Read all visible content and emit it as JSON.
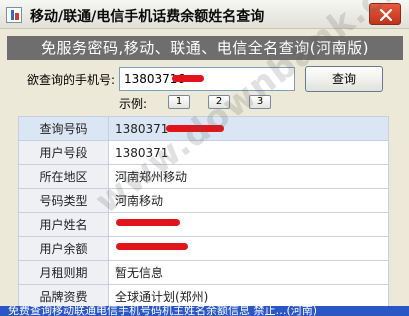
{
  "window": {
    "title": "移动/联通/电信手机话费余额姓名查询"
  },
  "banner": {
    "text": "免服务密码,移动、联通、电信全名查询(河南版)"
  },
  "query": {
    "label": "欲查询的手机号:",
    "value": "13803716",
    "button_label": "查询"
  },
  "examples": {
    "label": "示例:",
    "buttons": [
      "1",
      "2",
      "3"
    ]
  },
  "results": [
    {
      "key": "查询号码",
      "value": "1380371"
    },
    {
      "key": "用户号段",
      "value": "1380371"
    },
    {
      "key": "所在地区",
      "value": "河南郑州移动"
    },
    {
      "key": "号码类型",
      "value": "河南移动"
    },
    {
      "key": "用户姓名",
      "value": ""
    },
    {
      "key": "用户余额",
      "value": ""
    },
    {
      "key": "月租则期",
      "value": "暂无信息"
    },
    {
      "key": "品牌资费",
      "value": "全球通计划(郑州)"
    }
  ],
  "watermark": {
    "text": "www.downbank.cn"
  },
  "footer": {
    "text": "免费查询移动联通电信手机号码机主姓名余额信息  禁止…(河南)"
  },
  "colors": {
    "banner_bg": "#6e6e6e",
    "redaction": "#e3131a",
    "close_button": "#c0331b",
    "table_header_row": "#dae6f3"
  },
  "icons": {
    "app": "app-icon",
    "close": "close-icon"
  }
}
